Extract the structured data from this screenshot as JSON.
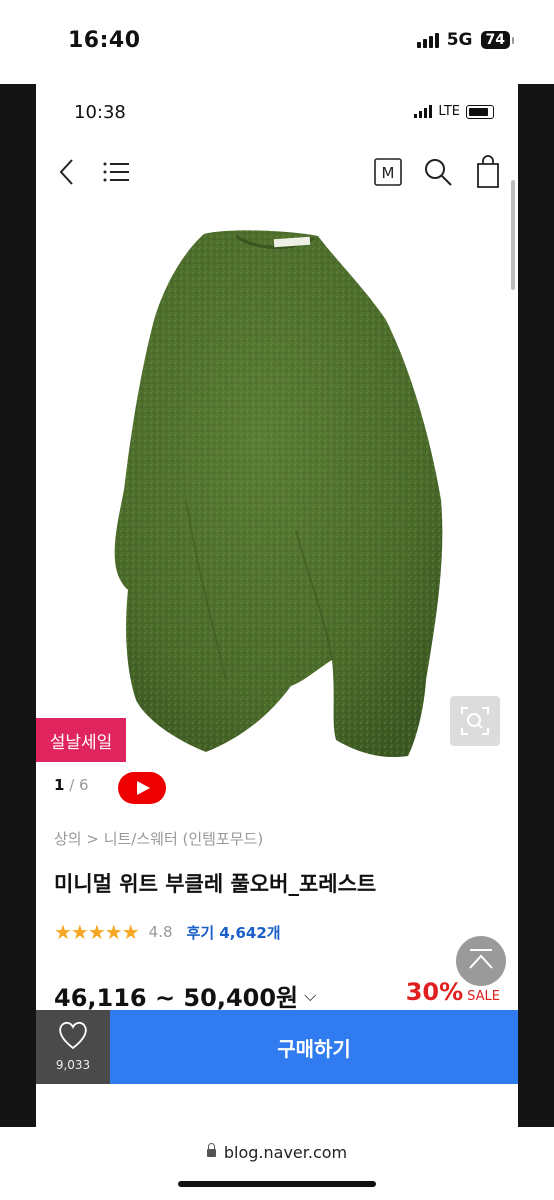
{
  "outer_status": {
    "time": "16:40",
    "network": "5G",
    "battery": "74"
  },
  "inner_status": {
    "time": "10:38",
    "network": "LTE"
  },
  "nav": {
    "back_icon": "chevron-left-icon",
    "menu_icon": "menu-icon",
    "m_icon_label": "M",
    "search_icon": "search-icon",
    "bag_icon": "shopping-bag-icon"
  },
  "image": {
    "badge": "설날세일",
    "current": "1",
    "total": "6",
    "color": "#4f6f2f"
  },
  "product": {
    "breadcrumb": "상의 > 니트/스웨터 (인템포무드)",
    "title": "미니멀 위트 부클레 풀오버_포레스트",
    "stars": "★★★★★",
    "rating": "4.8",
    "reviews": "후기 4,642개",
    "price": "46,116 ~ 50,400원",
    "discount": "30%",
    "sale_label": "SALE"
  },
  "bottom": {
    "wish_count": "9,033",
    "buy_label": "구매하기"
  },
  "browser": {
    "url": "blog.naver.com"
  },
  "colors": {
    "sale_badge": "#e0245e",
    "buy_button": "#2f7bef",
    "discount": "#e02020",
    "stars": "#f5a623",
    "review_link": "#1a5fc8"
  }
}
